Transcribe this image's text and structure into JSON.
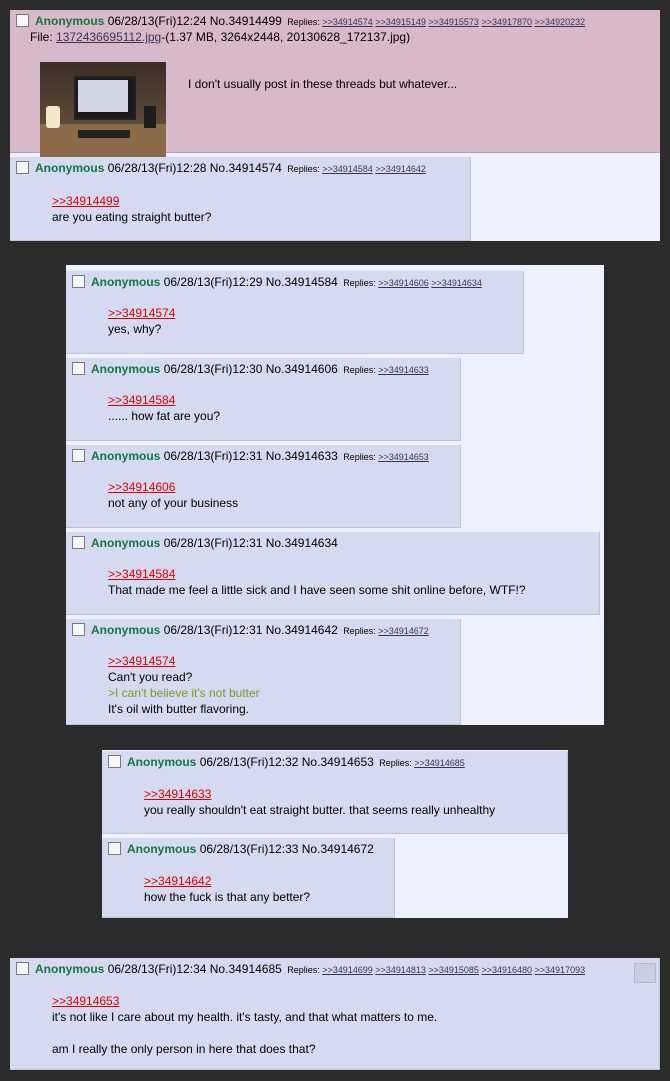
{
  "posts": [
    {
      "name": "Anonymous",
      "date": "06/28/13(Fri)12:24",
      "no": "No.34914499",
      "replies_label": "Replies:",
      "replies": [
        ">>34914574",
        ">>34915149",
        ">>34915573",
        ">>34917870",
        ">>34920232"
      ],
      "file_prefix": "File: ",
      "file_link": "1372436695112.jpg",
      "file_info": "-(1.37 MB, 3264x2448, 20130628_172137.jpg)",
      "text": [
        "I don't usually post in these threads but whatever..."
      ]
    },
    {
      "name": "Anonymous",
      "date": "06/28/13(Fri)12:28",
      "no": "No.34914574",
      "replies_label": "Replies:",
      "replies": [
        ">>34914584",
        ">>34914642"
      ],
      "quote": ">>34914499",
      "text": [
        "are you eating straight butter?"
      ]
    },
    {
      "name": "Anonymous",
      "date": "06/28/13(Fri)12:29",
      "no": "No.34914584",
      "replies_label": "Replies:",
      "replies": [
        ">>34914606",
        ">>34914634"
      ],
      "quote": ">>34914574",
      "text": [
        "yes, why?"
      ]
    },
    {
      "name": "Anonymous",
      "date": "06/28/13(Fri)12:30",
      "no": "No.34914606",
      "replies_label": "Replies:",
      "replies": [
        ">>34914633"
      ],
      "quote": ">>34914584",
      "text": [
        "...... how fat are you?"
      ]
    },
    {
      "name": "Anonymous",
      "date": "06/28/13(Fri)12:31",
      "no": "No.34914633",
      "replies_label": "Replies:",
      "replies": [
        ">>34914653"
      ],
      "quote": ">>34914606",
      "text": [
        "not any of your business"
      ]
    },
    {
      "name": "Anonymous",
      "date": "06/28/13(Fri)12:31",
      "no": "No.34914634",
      "replies_label": "",
      "replies": [],
      "quote": ">>34914584",
      "text": [
        "That made me feel a little sick and I have seen some shit online before, WTF!?"
      ]
    },
    {
      "name": "Anonymous",
      "date": "06/28/13(Fri)12:31",
      "no": "No.34914642",
      "replies_label": "Replies:",
      "replies": [
        ">>34914672"
      ],
      "quote": ">>34914574",
      "text": [
        "Can't you read?"
      ],
      "greentext": ">I can't believe it's not butter",
      "text2": "It's oil with butter flavoring."
    },
    {
      "name": "Anonymous",
      "date": "06/28/13(Fri)12:32",
      "no": "No.34914653",
      "replies_label": "Replies:",
      "replies": [
        ">>34914685"
      ],
      "quote": ">>34914633",
      "text": [
        "you really shouldn't eat straight butter. that seems really unhealthy"
      ]
    },
    {
      "name": "Anonymous",
      "date": "06/28/13(Fri)12:33",
      "no": "No.34914672",
      "replies_label": "",
      "replies": [],
      "quote": ">>34914642",
      "text": [
        "how the fuck is that any better?"
      ]
    },
    {
      "name": "Anonymous",
      "date": "06/28/13(Fri)12:34",
      "no": "No.34914685",
      "replies_label": "Replies:",
      "replies": [
        ">>34914699",
        ">>34914813",
        ">>34915085",
        ">>34916480",
        ">>34917093"
      ],
      "quote": ">>34914653",
      "text": [
        "it's not like I care about my health. it's tasty, and that what matters to me.",
        "am I really the only person in here that does that?"
      ]
    }
  ],
  "colors": {
    "name": "#117743",
    "quote": "#dd0000",
    "greentext": "#789922",
    "post_bg": "#d6daf0",
    "op_bg": "#d8b9c9",
    "page_bg": "#2b2b2b",
    "block_bg": "#eef2ff"
  }
}
